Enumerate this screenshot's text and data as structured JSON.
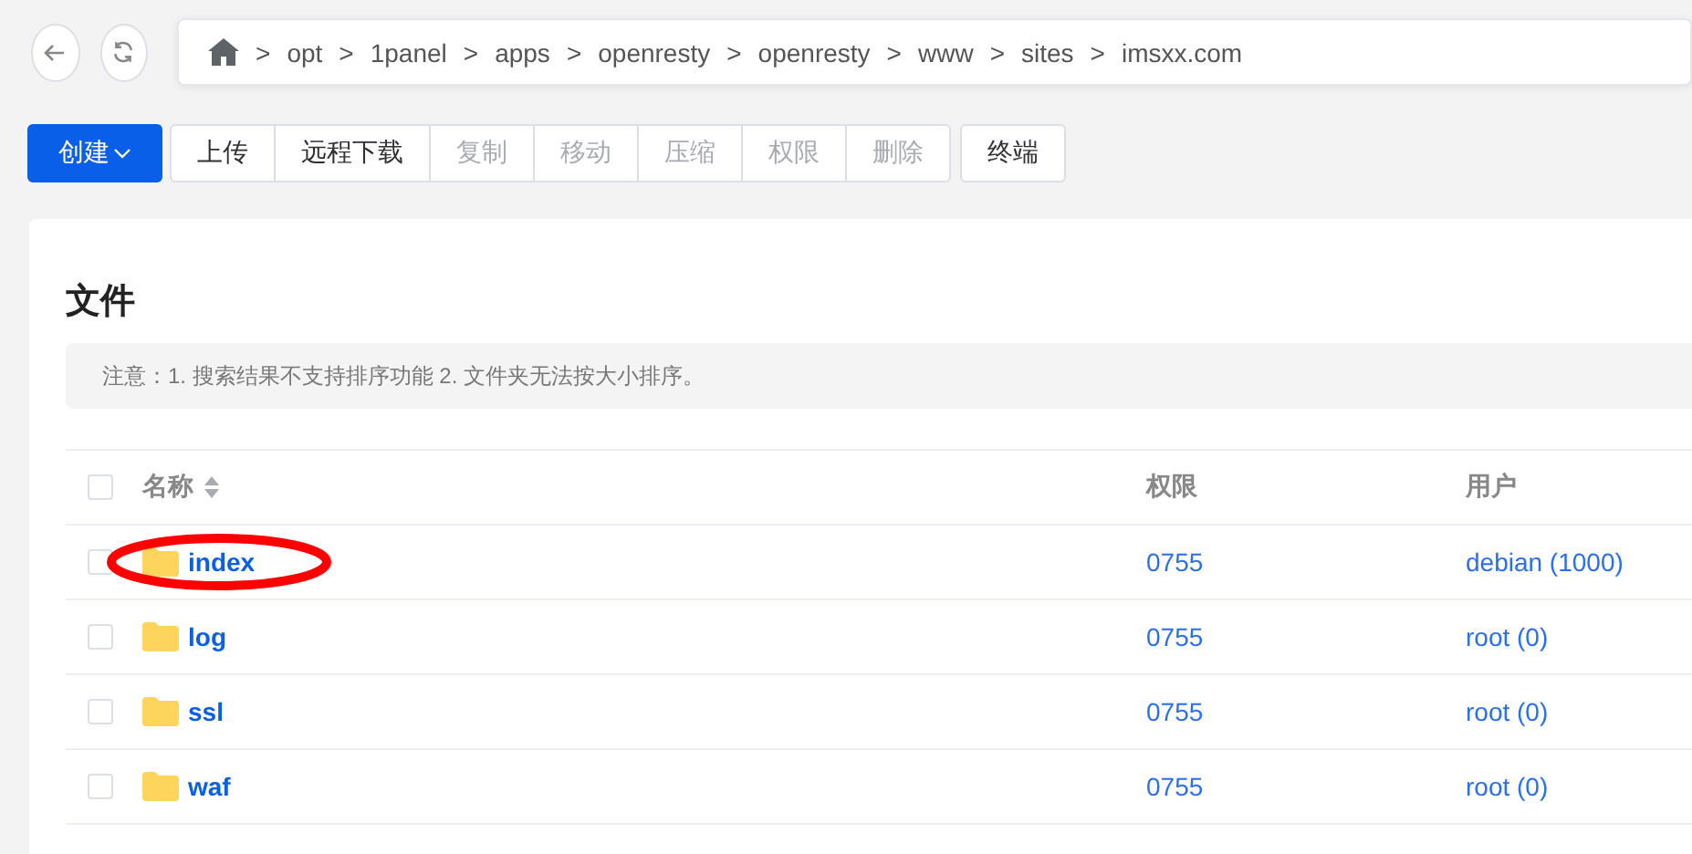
{
  "nav": {
    "path": [
      "opt",
      "1panel",
      "apps",
      "openresty",
      "openresty",
      "www",
      "sites",
      "imsxx.com"
    ],
    "separator": ">"
  },
  "toolbar": [
    {
      "label": "创建",
      "kind": "primary",
      "disabled": false
    },
    {
      "label": "上传",
      "kind": "group",
      "disabled": false
    },
    {
      "label": "远程下载",
      "kind": "group",
      "disabled": false
    },
    {
      "label": "复制",
      "kind": "group",
      "disabled": true
    },
    {
      "label": "移动",
      "kind": "group",
      "disabled": true
    },
    {
      "label": "压缩",
      "kind": "group",
      "disabled": true
    },
    {
      "label": "权限",
      "kind": "group",
      "disabled": true
    },
    {
      "label": "删除",
      "kind": "group",
      "disabled": true
    },
    {
      "label": "终端",
      "kind": "single",
      "disabled": false
    }
  ],
  "card": {
    "title": "文件",
    "notice": "注意：1. 搜索结果不支持排序功能 2. 文件夹无法按大小排序。"
  },
  "table": {
    "columns": [
      "名称",
      "权限",
      "用户"
    ],
    "select_all_checked": false,
    "rows": [
      {
        "name": "index",
        "mode": "0755",
        "user": "debian (1000)",
        "checked": false,
        "circled": true
      },
      {
        "name": "log",
        "mode": "0755",
        "user": "root (0)",
        "checked": false,
        "circled": false
      },
      {
        "name": "ssl",
        "mode": "0755",
        "user": "root (0)",
        "checked": false,
        "circled": false
      },
      {
        "name": "waf",
        "mode": "0755",
        "user": "root (0)",
        "checked": false,
        "circled": false
      }
    ]
  }
}
